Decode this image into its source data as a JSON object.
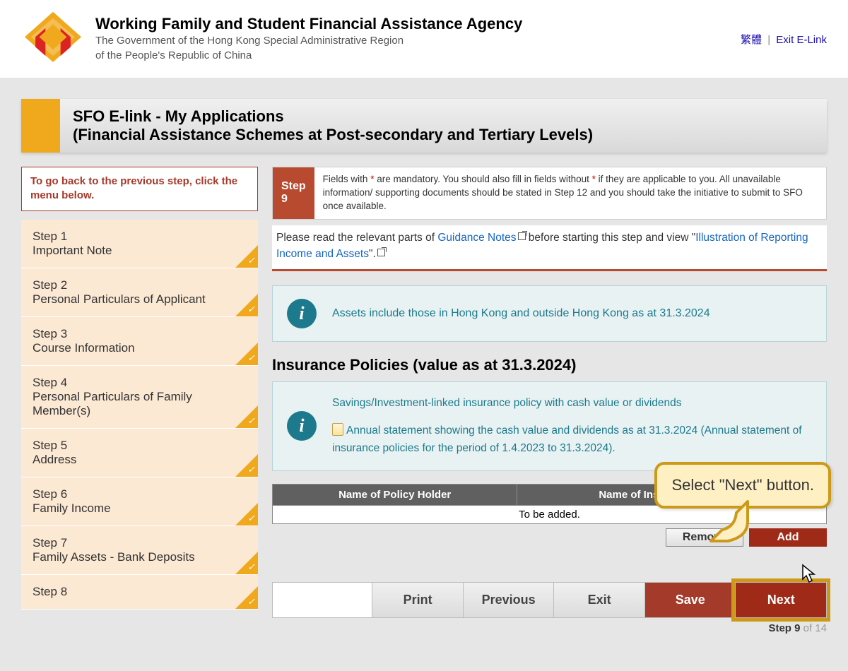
{
  "header": {
    "title": "Working Family and Student Financial Assistance Agency",
    "sub1": "The Government of the Hong Kong Special Administrative Region",
    "sub2": "of the People's Republic of China",
    "lang_link": "繁體",
    "exit_link": "Exit E-Link"
  },
  "page_title": {
    "line1": "SFO E-link - My Applications",
    "line2": "(Financial Assistance Schemes at Post-secondary and Tertiary Levels)"
  },
  "sidebar": {
    "hint": "To go back to the previous step, click the menu below.",
    "steps": [
      {
        "num": "Step 1",
        "label": "Important Note"
      },
      {
        "num": "Step 2",
        "label": "Personal Particulars of Applicant"
      },
      {
        "num": "Step 3",
        "label": "Course Information"
      },
      {
        "num": "Step 4",
        "label": "Personal Particulars of Family Member(s)"
      },
      {
        "num": "Step 5",
        "label": "Address"
      },
      {
        "num": "Step 6",
        "label": "Family Income"
      },
      {
        "num": "Step 7",
        "label": "Family Assets - Bank Deposits"
      },
      {
        "num": "Step 8",
        "label": ""
      }
    ]
  },
  "banner": {
    "badge": "Step 9",
    "text_before": "Fields with ",
    "text_mid": " are mandatory. You should also fill in fields without ",
    "text_after": " if they are applicable to you. All unavailable information/ supporting documents should be stated in Step 12 and you should take the initiative to submit to SFO once available."
  },
  "guidance": {
    "pre": "Please read the relevant parts of ",
    "link1": "Guidance Notes",
    "mid": " before starting this step and view \"",
    "link2": "Illustration of Reporting Income and Assets",
    "post": "\"."
  },
  "info1": "Assets include those in Hong Kong and outside Hong Kong as at 31.3.2024",
  "section_heading": "Insurance Policies (value as at 31.3.2024)",
  "insurance": {
    "line1": "Savings/Investment-linked insurance policy with cash value or dividends",
    "line2": "Annual statement showing the cash value and dividends as at 31.3.2024 (Annual statement of insurance policies for the period of 1.4.2023 to 31.3.2024)."
  },
  "table": {
    "col1": "Name of Policy Holder",
    "col2": "Name of Insurance Company",
    "row_placeholder": "To be added."
  },
  "table_actions": {
    "remove": "Remove",
    "add": "Add"
  },
  "footer": {
    "print": "Print",
    "previous": "Previous",
    "exit": "Exit",
    "save": "Save",
    "next": "Next"
  },
  "pager": {
    "label": "Step 9",
    "of": " of 14"
  },
  "callout": "Select \"Next\" button."
}
